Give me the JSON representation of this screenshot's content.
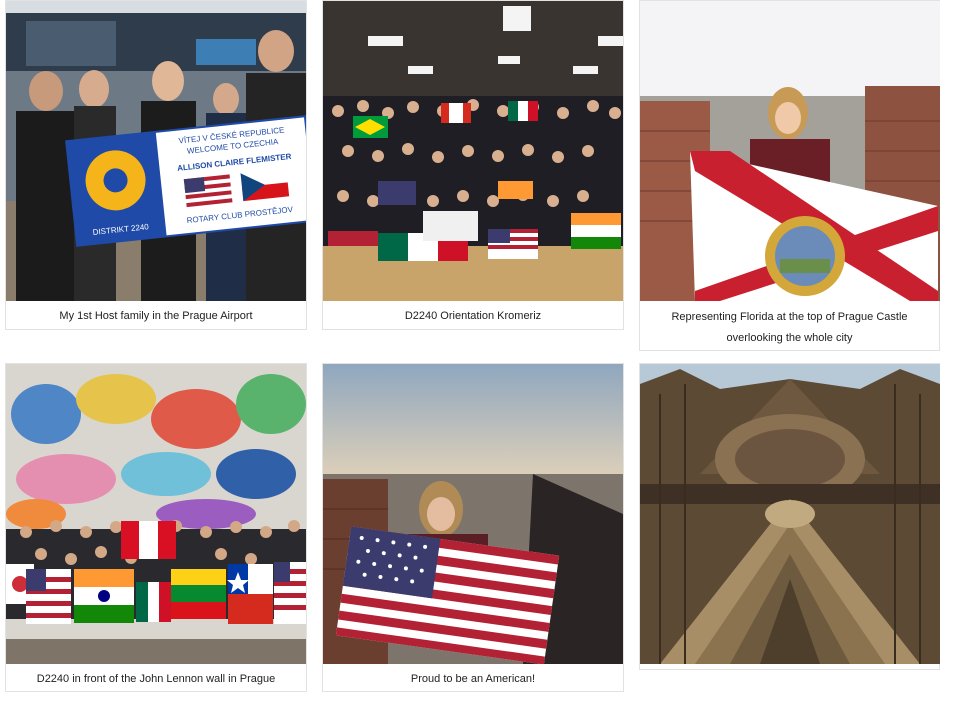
{
  "gallery": {
    "items": [
      {
        "caption": "My 1st Host family in the Prague Airport",
        "banner_line1": "VÍTEJ V ČESKÉ REPUBLICE",
        "banner_line2": "WELCOME TO CZECHIA",
        "banner_name": "ALLISON CLAIRE FLEMISTER",
        "banner_club": "ROTARY CLUB PROSTĚJOV",
        "banner_district": "DISTRIKT 2240"
      },
      {
        "caption": "D2240 Orientation Kromeriz"
      },
      {
        "caption": "Representing Florida at the top of Prague Castle overlooking the whole city"
      },
      {
        "caption": "D2240 in front of the John Lennon wall in Prague"
      },
      {
        "caption": "Proud to be an American!"
      },
      {
        "caption": ""
      }
    ]
  },
  "colors": {
    "rotary_blue": "#1f4aa8",
    "rotary_gold": "#f4b41a",
    "florida_red": "#c8202f",
    "us_red": "#b22234",
    "us_blue": "#3c3b6e"
  }
}
